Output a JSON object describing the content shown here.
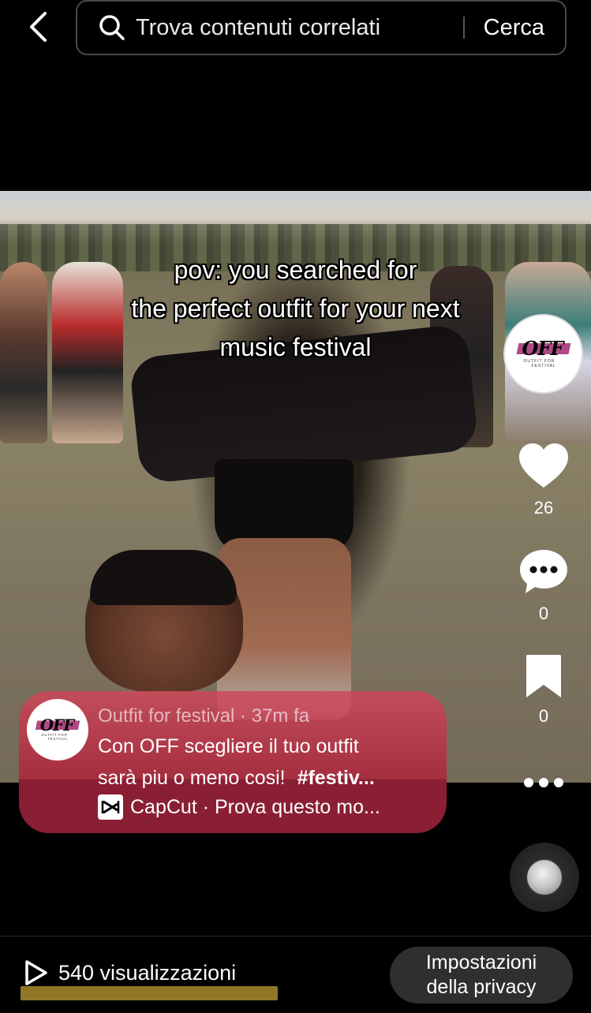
{
  "search": {
    "placeholder": "Trova contenuti correlati",
    "submit_label": "Cerca"
  },
  "video": {
    "caption_lines": [
      "pov: you searched for",
      "the perfect outfit for your next",
      "music festival"
    ]
  },
  "creator": {
    "logo_text": "OFF",
    "logo_subtitle_1": "OUTFIT FOR",
    "logo_subtitle_2": "FESTIVAL"
  },
  "actions": {
    "likes": "26",
    "comments": "0",
    "saves": "0"
  },
  "info_card": {
    "author_line": "Outfit for festival · 37m fa",
    "description_line1": "Con OFF scegliere il tuo outfit",
    "description_line2_text": "sarà piu o meno cosi!",
    "hashtag": "#festiv...",
    "template_label": "CapCut · Prova questo mo..."
  },
  "footer": {
    "views": "540 visualizzazioni",
    "privacy_line1": "Impostazioni",
    "privacy_line2": "della privacy"
  },
  "colors": {
    "background": "#000000",
    "card_accent": "#8a1f33",
    "logo_accent": "#b04a86",
    "views_highlight": "#a88c2c"
  },
  "icons": [
    "back-arrow-icon",
    "search-icon",
    "heart-icon",
    "comment-icon",
    "bookmark-icon",
    "more-icon",
    "capcut-icon",
    "music-disc-icon",
    "play-icon"
  ]
}
